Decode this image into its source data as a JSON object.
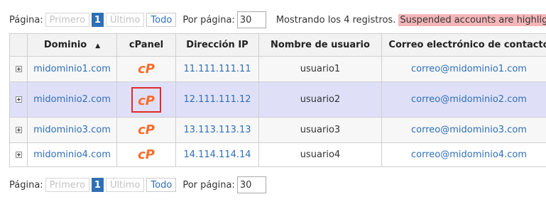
{
  "pager": {
    "label": "Página:",
    "first": "Primero",
    "page_num": "1",
    "last": "Último",
    "all": "Todo",
    "per_page_label": "Por página:",
    "per_page_value": "30"
  },
  "status": {
    "showing": "Mostrando los 4 registros.",
    "suspended_notice": "Suspended accounts are highlig"
  },
  "table": {
    "headers": {
      "domain": "Dominio",
      "sort_icon": "▲",
      "cpanel": "cPanel",
      "ip": "Dirección IP",
      "user": "Nombre de usuario",
      "email": "Correo electrónico de contacto"
    },
    "rows": [
      {
        "domain": "midominio1.com",
        "ip": "11.111.111.11",
        "user": "usuario1",
        "email": "correo@midominio1.com"
      },
      {
        "domain": "midominio2.com",
        "ip": "12.111.111.12",
        "user": "usuario2",
        "email": "correo@midominio2.com"
      },
      {
        "domain": "midominio3.com",
        "ip": "13.113.113.13",
        "user": "usuario3",
        "email": "correo@midominio3.com"
      },
      {
        "domain": "midominio4.com",
        "ip": "14.114.114.14",
        "user": "usuario4",
        "email": "correo@midominio4.com"
      }
    ]
  },
  "colors": {
    "link": "#2f6fb6",
    "cpanel_orange": "#ff6c2c",
    "highlight_row": "#dfe0f8",
    "suspended_bg": "#f4b6b9",
    "selection_border": "#e02b2b"
  },
  "icons": {
    "expand": "plus-square-icon",
    "cpanel": "cpanel-logo-icon"
  }
}
